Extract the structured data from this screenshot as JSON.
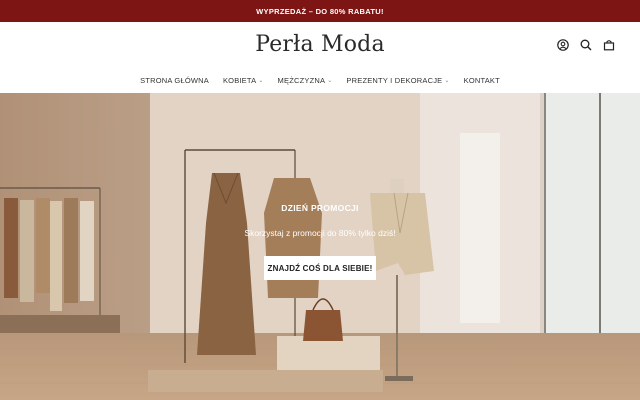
{
  "announcement": {
    "text": "WYPRZEDAŻ – DO 80% RABATU!"
  },
  "header": {
    "logo": "Perła Moda",
    "icons": [
      "user-icon",
      "search-icon",
      "bag-icon"
    ]
  },
  "nav": {
    "items": [
      {
        "label": "STRONA GŁÓWNA",
        "has_dropdown": false
      },
      {
        "label": "KOBIETA",
        "has_dropdown": true
      },
      {
        "label": "MĘŻCZYZNA",
        "has_dropdown": true
      },
      {
        "label": "PREZENTY I DEKORACJE",
        "has_dropdown": true
      },
      {
        "label": "KONTAKT",
        "has_dropdown": false
      }
    ]
  },
  "hero": {
    "title": "DZIEŃ PROMOCJI",
    "subtitle": "Skorzystaj z promocji do 80% tylko dziś!",
    "cta": "ZNAJDŹ COŚ DLA SIEBIE!"
  },
  "colors": {
    "announcement_bg": "#7d1515",
    "text_dark": "#222222",
    "button_bg": "#ffffff"
  }
}
